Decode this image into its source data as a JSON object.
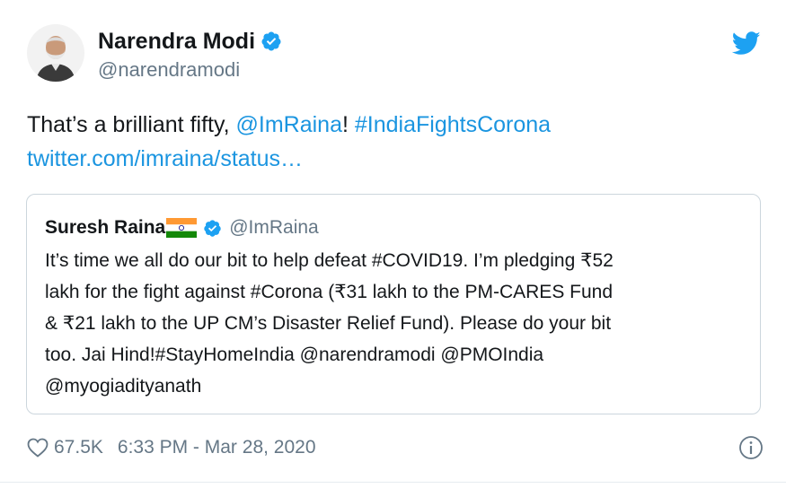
{
  "author": {
    "display_name": "Narendra Modi",
    "handle": "@narendramodi",
    "avatar_icon": "person-avatar",
    "verified_icon": "verified-badge-icon"
  },
  "tweet": {
    "text_prefix": "That’s a brilliant fifty, ",
    "mention": "@ImRaina",
    "text_mid": "! ",
    "hashtag": "#IndiaFightsCorona",
    "url": "twitter.com/imraina/status…"
  },
  "quoted": {
    "display_name": "Suresh Raina",
    "handle": "@ImRaina",
    "flag_icon": "india-flag-icon",
    "text": "It’s time we all do our bit to help defeat #COVID19. I’m pledging ₹52\nlakh for the fight against #Corona (₹31 lakh to the  PM-CARES Fund\n& ₹21 lakh to the UP CM’s Disaster Relief Fund). Please do your bit\ntoo. Jai Hind!#StayHomeIndia @narendramodi @PMOIndia\n@myogiadityanath"
  },
  "footer": {
    "likes": "67.5K",
    "timestamp": "6:33 PM - Mar 28, 2020",
    "heart_icon": "heart-icon",
    "info_icon": "info-icon"
  },
  "colors": {
    "link": "#1b95e0",
    "secondary_text": "#657786",
    "verified": "#1da1f2",
    "border": "#ccd6dd"
  }
}
